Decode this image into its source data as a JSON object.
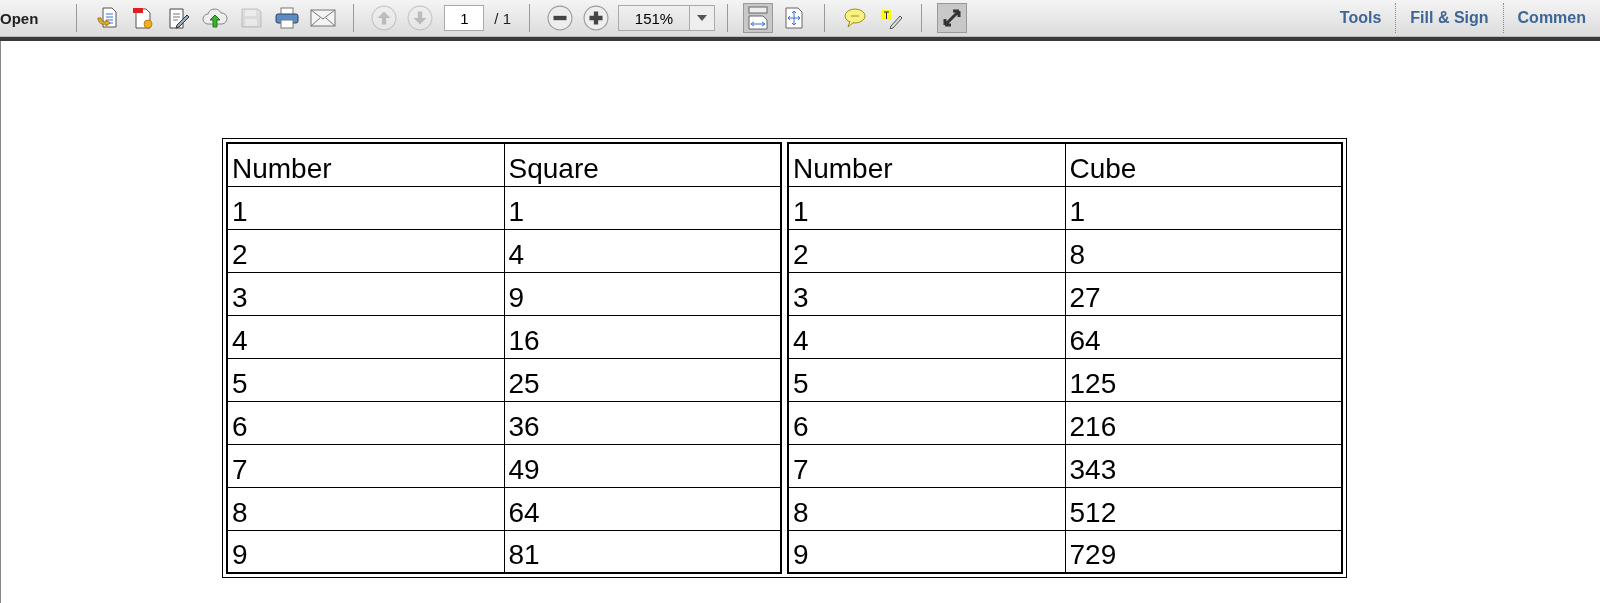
{
  "toolbar": {
    "open_label": "Open",
    "file_buttons": [
      {
        "disabled": false
      },
      {
        "disabled": false
      },
      {
        "disabled": false
      },
      {
        "disabled": false
      },
      {
        "disabled": true
      },
      {
        "disabled": false
      },
      {
        "disabled": false
      }
    ],
    "page_buttons": [
      {
        "disabled": true
      },
      {
        "disabled": true
      }
    ],
    "page_number": "1",
    "page_total": "/ 1",
    "zoom_value": "151%",
    "view_buttons": [
      {
        "on": true
      },
      {
        "on": false
      }
    ],
    "right_tabs": [
      "Tools",
      "Fill & Sign",
      "Commen"
    ]
  },
  "tables": [
    {
      "columns": [
        "Number",
        "Square"
      ],
      "rows": [
        [
          "1",
          "1"
        ],
        [
          "2",
          "4"
        ],
        [
          "3",
          "9"
        ],
        [
          "4",
          "16"
        ],
        [
          "5",
          "25"
        ],
        [
          "6",
          "36"
        ],
        [
          "7",
          "49"
        ],
        [
          "8",
          "64"
        ],
        [
          "9",
          "81"
        ]
      ]
    },
    {
      "columns": [
        "Number",
        "Cube"
      ],
      "rows": [
        [
          "1",
          "1"
        ],
        [
          "2",
          "8"
        ],
        [
          "3",
          "27"
        ],
        [
          "4",
          "64"
        ],
        [
          "5",
          "125"
        ],
        [
          "6",
          "216"
        ],
        [
          "7",
          "343"
        ],
        [
          "8",
          "512"
        ],
        [
          "9",
          "729"
        ]
      ]
    }
  ]
}
